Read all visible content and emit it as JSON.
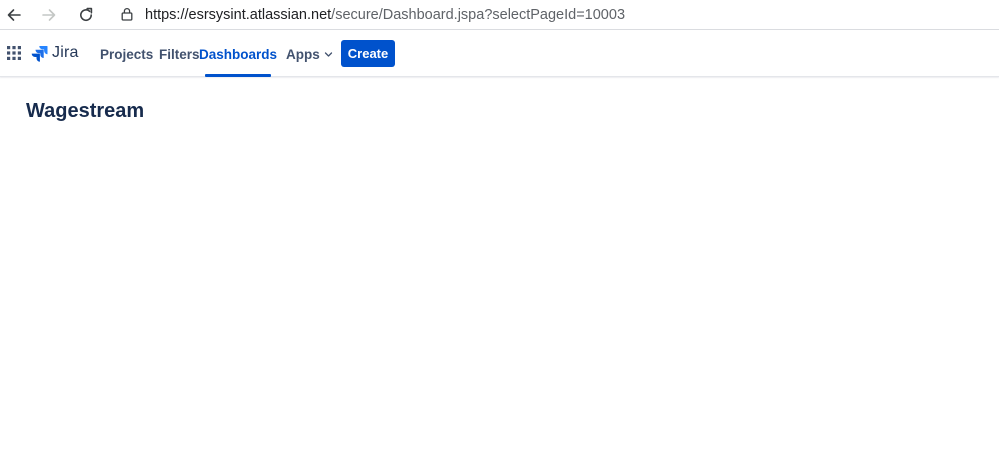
{
  "browser": {
    "url_host": "https://esrsysint.atlassian.net",
    "url_path": "/secure/Dashboard.jspa?selectPageId=10003",
    "icons": {
      "back": "back-arrow-icon",
      "forward": "forward-arrow-icon",
      "reload": "reload-icon",
      "lock": "lock-icon"
    }
  },
  "jira_nav": {
    "logo_text": "Jira",
    "items": [
      {
        "label": "Projects"
      },
      {
        "label": "Filters"
      },
      {
        "label": "Dashboards",
        "active": true
      },
      {
        "label": "Apps"
      }
    ],
    "create_label": "Create",
    "colors": {
      "brand_blue": "#0052cc",
      "nav_text": "#42526e"
    }
  },
  "page": {
    "title": "Wagestream"
  }
}
